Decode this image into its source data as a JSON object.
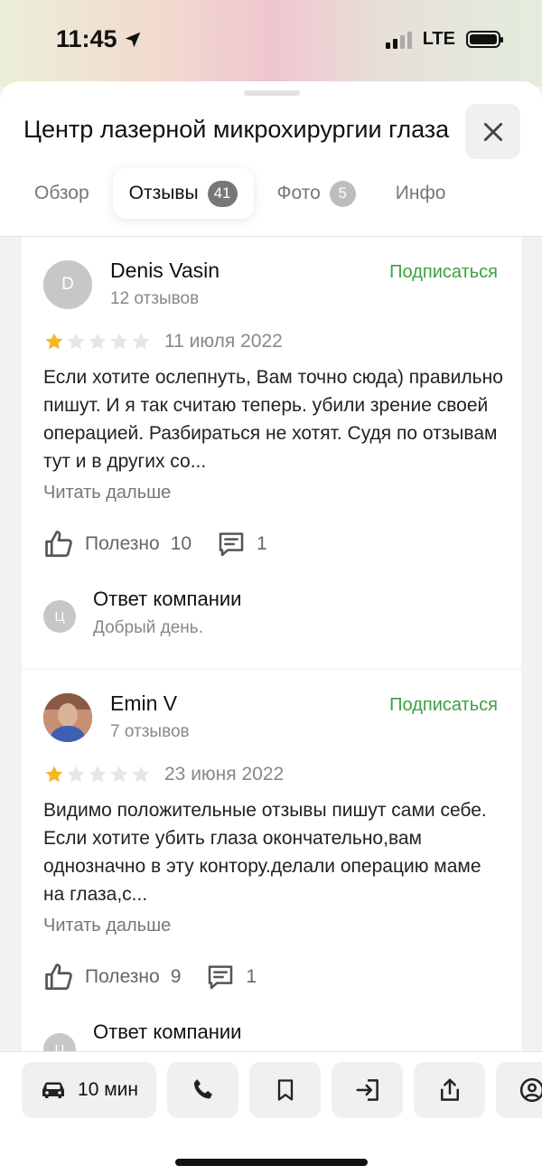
{
  "status_bar": {
    "time": "11:45",
    "network": "LTE"
  },
  "header": {
    "title": "Центр лазерной микрохирургии глаза",
    "tabs": [
      {
        "label": "Обзор",
        "badge": ""
      },
      {
        "label": "Отзывы",
        "badge": "41"
      },
      {
        "label": "Фото",
        "badge": "5"
      },
      {
        "label": "Инфо",
        "badge": ""
      }
    ],
    "active_tab": "Отзывы"
  },
  "reviews": [
    {
      "initial": "D",
      "author": "Denis Vasin",
      "review_count": "12 отзывов",
      "subscribe_label": "Подписаться",
      "rating": 1,
      "date": "11 июля 2022",
      "text": "Если хотите ослепнуть, Вам точно сюда) правильно пишут. И я так считаю теперь. убили зрение своей операцией. Разбираться не хотят. Судя по отзывам тут и в других со...",
      "read_more": "Читать дальше",
      "helpful_label": "Полезно",
      "helpful_count": "10",
      "comments_count": "1",
      "reply": {
        "initial": "Ц",
        "title": "Ответ компании",
        "text": "Добрый день."
      }
    },
    {
      "initial": "",
      "author": "Emin V",
      "review_count": "7 отзывов",
      "subscribe_label": "Подписаться",
      "rating": 1,
      "date": "23 июня 2022",
      "text": "Видимо положительные отзывы пишут сами себе. Если хотите убить глаза окончательно,вам однозначно в эту контору.делали операцию маме на глаза,с...",
      "read_more": "Читать дальше",
      "helpful_label": "Полезно",
      "helpful_count": "9",
      "comments_count": "1",
      "reply": {
        "initial": "Ц",
        "title": "Ответ компании",
        "text": ""
      }
    }
  ],
  "bottom_bar": {
    "route_time": "10 мин"
  },
  "colors": {
    "accent_green": "#3ca142",
    "star_filled": "#f5b624",
    "star_empty": "#e6e6e6"
  }
}
